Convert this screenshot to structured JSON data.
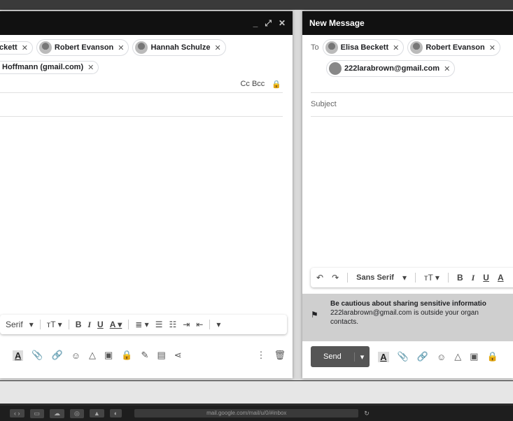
{
  "left_window": {
    "controls": [
      "_",
      "⤢",
      "✕"
    ],
    "recipient_chips": [
      {
        "name": "ckett",
        "avatar": false
      },
      {
        "name": "Robert Evanson",
        "avatar": true
      },
      {
        "name": "Hannah Schulze",
        "avatar": true
      }
    ],
    "recipient_chip_row2": "Hoffmann (gmail.com)",
    "cc_bcc": "Cc Bcc",
    "toolbar": {
      "font": "Serif",
      "items": [
        "▾",
        "тT ▾",
        "B",
        "I",
        "U",
        "A ▾",
        "≣ ▾",
        "☰",
        "☷",
        "⇥",
        "⇤",
        "▾"
      ]
    },
    "bottom_icons": [
      "A",
      "📎",
      "🔗",
      "☺",
      "△",
      "▣",
      "🔒",
      "✎",
      "▤",
      "⋖",
      "⋮",
      "🗑"
    ]
  },
  "right_window": {
    "title": "New Message",
    "to_label": "To",
    "recipient_chips": [
      {
        "name": "Elisa Beckett"
      },
      {
        "name": "Robert Evanson"
      }
    ],
    "recipient_chip_row2": "222larabrown@gmail.com",
    "subject_placeholder": "Subject",
    "toolbar": {
      "undo": "↶",
      "redo": "↷",
      "font": "Sans Serif",
      "items": [
        "▾",
        "тT ▾",
        "B",
        "I",
        "U",
        "A"
      ]
    },
    "warning": {
      "title": "Be cautious about sharing sensitive informatio",
      "body_line1": "222larabrown@gmail.com is outside your organ",
      "body_line2": "contacts."
    },
    "send_label": "Send",
    "send_dropdown": "▾",
    "bottom_icons": [
      "A",
      "📎",
      "🔗",
      "☺",
      "△",
      "▣",
      "🔒"
    ]
  },
  "dock": {
    "url": "mail.google.com/mail/u/0/#inbox"
  }
}
